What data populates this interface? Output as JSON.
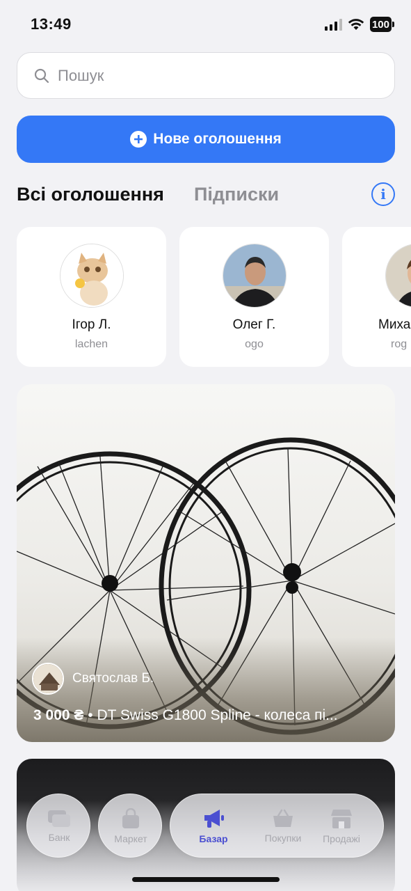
{
  "status_bar": {
    "time": "13:49",
    "battery": "100"
  },
  "search": {
    "placeholder": "Пошук"
  },
  "new_listing_button": {
    "label": "Нове оголошення"
  },
  "tabs": [
    {
      "label": "Всі оголошення",
      "active": true
    },
    {
      "label": "Підписки",
      "active": false
    }
  ],
  "sellers": [
    {
      "name": "Ігор Л.",
      "handle": "lachen"
    },
    {
      "name": "Олег Г.",
      "handle": "ogo"
    },
    {
      "name": "Миха",
      "handle": "rog"
    }
  ],
  "listings": [
    {
      "seller": "Святослав Б.",
      "price": "3 000 ₴",
      "separator": "•",
      "title": "DT Swiss G1800 Spline - колеса пі..."
    }
  ],
  "bottom_nav": [
    {
      "label": "Банк",
      "icon": "cards-icon"
    },
    {
      "label": "Маркет",
      "icon": "bag-icon"
    },
    {
      "label": "Базар",
      "icon": "megaphone-icon",
      "active": true
    },
    {
      "label": "Покупки",
      "icon": "basket-icon"
    },
    {
      "label": "Продажі",
      "icon": "store-icon"
    }
  ],
  "colors": {
    "accent": "#3478f6",
    "nav_active": "#4b4fd1",
    "muted": "#8e8e93"
  }
}
